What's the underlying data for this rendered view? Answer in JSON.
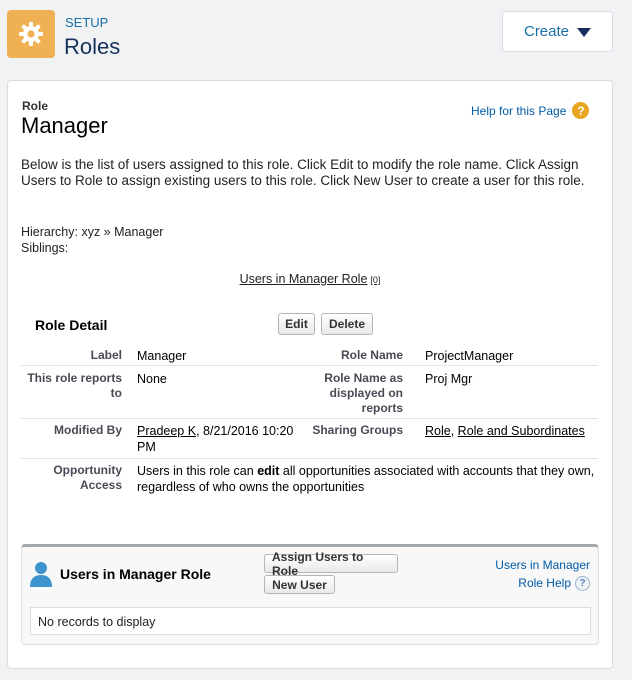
{
  "header": {
    "kicker": "SETUP",
    "title": "Roles",
    "create_label": "Create"
  },
  "role": {
    "label": "Role",
    "name": "Manager",
    "help_link": "Help for this Page",
    "description": "Below is the list of users assigned to this role. Click Edit to modify the role name. Click Assign Users to Role to assign existing users to this role. Click New User to create a user for this role.",
    "hierarchy_label": "Hierarchy:",
    "hierarchy_value": "xyz » Manager",
    "siblings_label": "Siblings:",
    "related_link": "Users in Manager Role",
    "related_count": "[0]"
  },
  "detail": {
    "title": "Role Detail",
    "edit_label": "Edit",
    "delete_label": "Delete",
    "label_label": "Label",
    "label_value": "Manager",
    "role_name_label": "Role Name",
    "role_name_value": "ProjectManager",
    "reports_to_label": "This role reports to",
    "reports_to_value": "None",
    "display_name_label": "Role Name as displayed on reports",
    "display_name_value": "Proj Mgr",
    "modified_by_label": "Modified By",
    "modified_by_user": "Pradeep K",
    "modified_by_date": ", 8/21/2016 10:20 PM",
    "sharing_groups_label": "Sharing Groups",
    "sharing_group_1": "Role",
    "sharing_group_2": "Role and Subordinates",
    "opportunity_label": "Opportunity Access",
    "opportunity_pre": "Users in this role can ",
    "opportunity_bold": "edit",
    "opportunity_post": " all opportunities associated with accounts that they own, regardless of who owns the opportunities"
  },
  "related_list": {
    "title": "Users in Manager Role",
    "assign_label": "Assign Users to Role",
    "new_user_label": "New User",
    "help_line1": "Users in Manager",
    "help_line2": "Role Help",
    "empty_text": "No records to display"
  },
  "icons": {
    "setup": "gear-icon",
    "help": "question-icon",
    "users": "user-icon",
    "create_caret": "caret-down-icon"
  },
  "colors": {
    "accent": "#1a6fa8",
    "setup_icon_bg": "#f0b054",
    "link": "#015ba7",
    "help_badge": "#e8a520"
  }
}
